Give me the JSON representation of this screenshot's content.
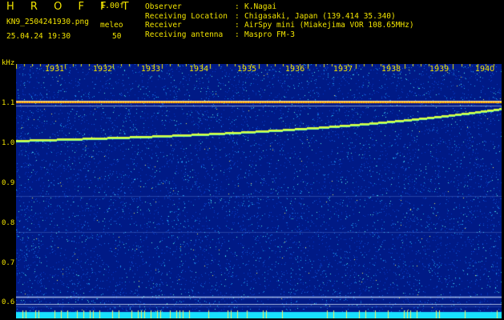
{
  "header": {
    "app_title": "H R O F F T",
    "version": "1.00f",
    "filename": "KN9_2504241930.png",
    "datetime": "25.04.24 19:30",
    "meleo_label": "meleo",
    "meleo_value": "50"
  },
  "meta": [
    {
      "label": "Observer",
      "value": "K.Nagai"
    },
    {
      "label": "Receiving Location",
      "value": "Chigasaki, Japan (139.414 35.340)"
    },
    {
      "label": "Receiver",
      "value": "AirSpy mini (Miakejima VOR 108.65MHz)"
    },
    {
      "label": "Receiving antenna",
      "value": "Maspro FM-3"
    }
  ],
  "axes": {
    "y_unit": "kHz",
    "y_ticks": [
      "1.1",
      "1.0",
      "0.9",
      "0.8",
      "0.7",
      "0.6"
    ],
    "x_ticks": [
      "1931",
      "1932",
      "1933",
      "1934",
      "1935",
      "1936",
      "1937",
      "1938",
      "1939",
      "1940"
    ]
  },
  "colors": {
    "background": "#001a86",
    "label": "#f2e400",
    "carrier": "#ffd000",
    "drift": "#d8ff40"
  }
}
